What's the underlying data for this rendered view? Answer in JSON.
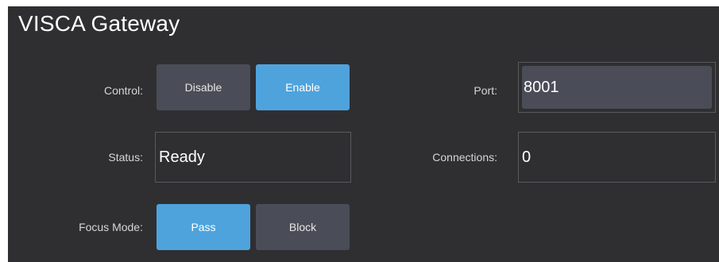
{
  "title": "VISCA Gateway",
  "control": {
    "label": "Control:",
    "options": [
      "Disable",
      "Enable"
    ],
    "selected": "Enable"
  },
  "port": {
    "label": "Port:",
    "value": "8001"
  },
  "status": {
    "label": "Status:",
    "value": "Ready"
  },
  "connections": {
    "label": "Connections:",
    "value": "0"
  },
  "focus_mode": {
    "label": "Focus Mode:",
    "options": [
      "Pass",
      "Block"
    ],
    "selected": "Pass"
  },
  "colors": {
    "panel_bg": "#2f2f32",
    "button_off": "#4a4d57",
    "button_on": "#4ea3dd"
  }
}
